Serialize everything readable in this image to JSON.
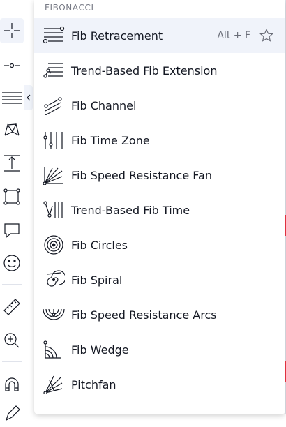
{
  "section": {
    "title": "FIBONACCI"
  },
  "items": [
    {
      "label": "Fib Retracement",
      "shortcut": "Alt + F",
      "icon": "fib-retracement-icon",
      "hovered": true
    },
    {
      "label": "Trend-Based Fib Extension",
      "icon": "trend-based-fib-extension-icon"
    },
    {
      "label": "Fib Channel",
      "icon": "fib-channel-icon"
    },
    {
      "label": "Fib Time Zone",
      "icon": "fib-time-zone-icon"
    },
    {
      "label": "Fib Speed Resistance Fan",
      "icon": "fib-speed-resistance-fan-icon"
    },
    {
      "label": "Trend-Based Fib Time",
      "icon": "trend-based-fib-time-icon"
    },
    {
      "label": "Fib Circles",
      "icon": "fib-circles-icon"
    },
    {
      "label": "Fib Spiral",
      "icon": "fib-spiral-icon"
    },
    {
      "label": "Fib Speed Resistance Arcs",
      "icon": "fib-speed-resistance-arcs-icon"
    },
    {
      "label": "Fib Wedge",
      "icon": "fib-wedge-icon"
    },
    {
      "label": "Pitchfan",
      "icon": "pitchfan-icon"
    }
  ],
  "toolbar": {
    "tools": [
      "crosshair-icon",
      "trend-line-icon",
      "fib-tools-icon",
      "patterns-icon",
      "measure-icon",
      "shapes-icon",
      "comment-icon",
      "emoji-icon",
      "ruler-icon",
      "zoom-in-icon",
      "magnet-icon",
      "pencil-icon"
    ]
  },
  "colors": {
    "hover_bg": "#f0f3fa",
    "text": "#131722",
    "muted": "#787b86",
    "accent_red": "#f23645"
  }
}
